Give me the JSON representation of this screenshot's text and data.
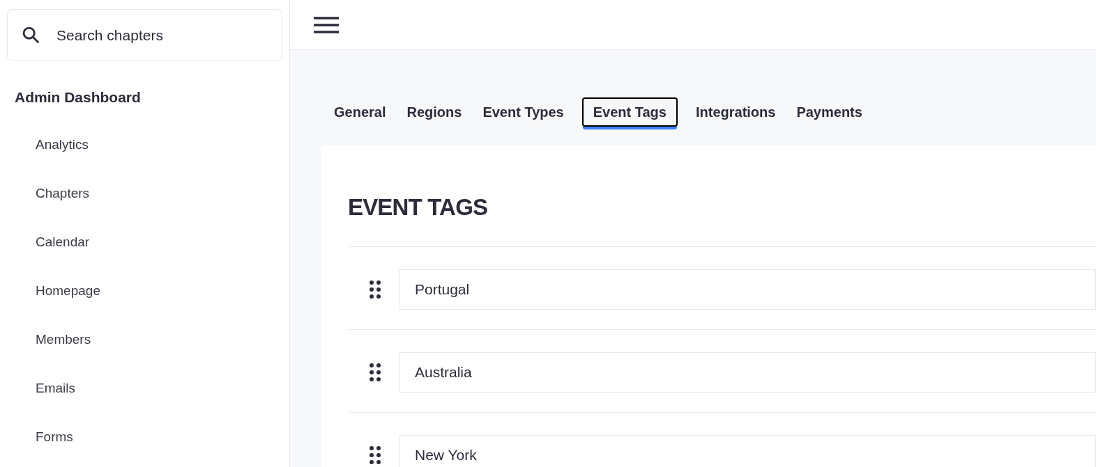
{
  "sidebar": {
    "search": {
      "placeholder": "Search chapters"
    },
    "heading": "Admin Dashboard",
    "items": [
      {
        "label": "Analytics"
      },
      {
        "label": "Chapters"
      },
      {
        "label": "Calendar"
      },
      {
        "label": "Homepage"
      },
      {
        "label": "Members"
      },
      {
        "label": "Emails"
      },
      {
        "label": "Forms"
      }
    ]
  },
  "tabs": [
    {
      "label": "General",
      "selected": false
    },
    {
      "label": "Regions",
      "selected": false
    },
    {
      "label": "Event Types",
      "selected": false
    },
    {
      "label": "Event Tags",
      "selected": true
    },
    {
      "label": "Integrations",
      "selected": false
    },
    {
      "label": "Payments",
      "selected": false
    }
  ],
  "section": {
    "title": "EVENT TAGS",
    "tags": [
      {
        "value": "Portugal"
      },
      {
        "value": "Australia"
      },
      {
        "value": "New York"
      }
    ]
  }
}
